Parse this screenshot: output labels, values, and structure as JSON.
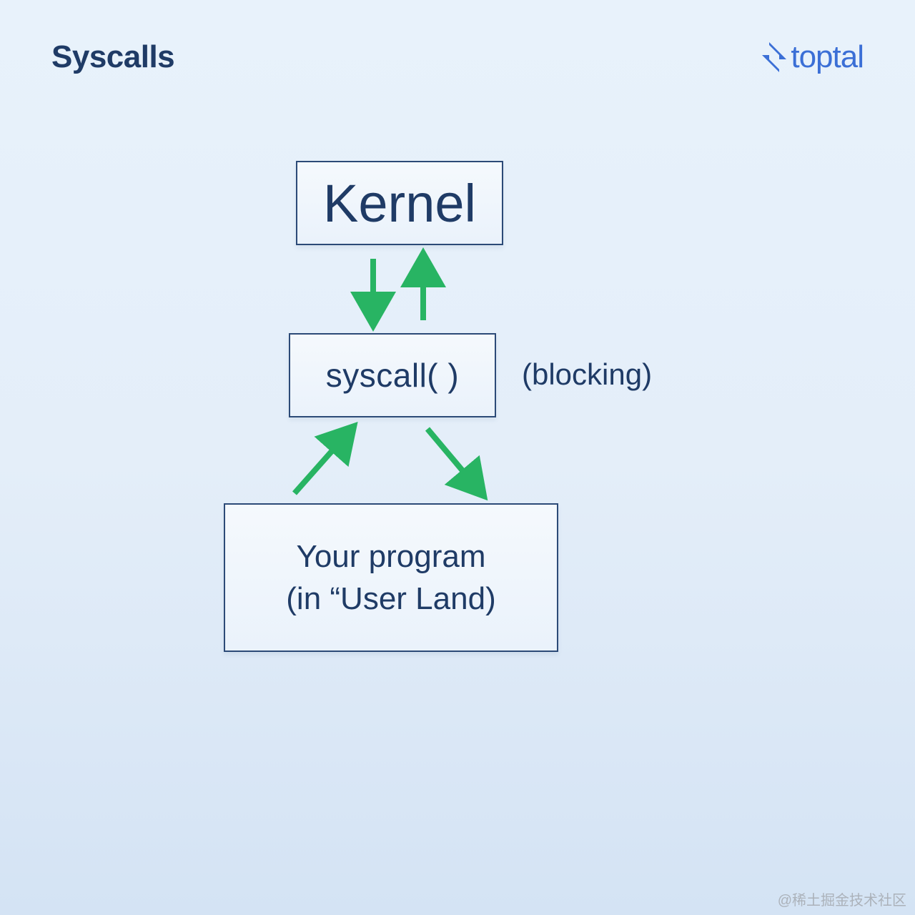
{
  "title": "Syscalls",
  "logo_text": "toptal",
  "boxes": {
    "kernel": "Kernel",
    "syscall": "syscall( )",
    "program": "Your program\n(in “User Land)"
  },
  "annotation": "(blocking)",
  "attribution": "@稀土掘金技术社区",
  "colors": {
    "text": "#1f3b66",
    "border": "#2c4a77",
    "arrow": "#28b463",
    "logo": "#3b6fd6",
    "bg_top": "#e8f2fb",
    "bg_bottom": "#d4e3f4"
  }
}
